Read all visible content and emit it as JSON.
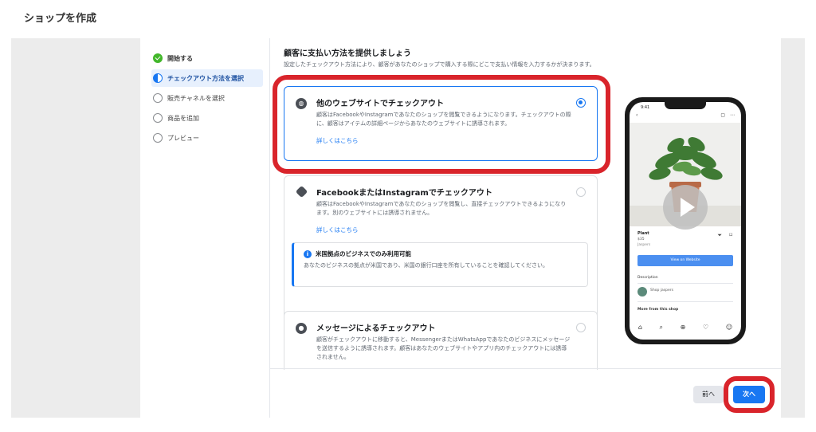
{
  "page": {
    "title": "ショップを作成"
  },
  "steps": [
    {
      "label": "開始する",
      "state": "done"
    },
    {
      "label": "チェックアウト方法を選択",
      "state": "active"
    },
    {
      "label": "販売チャネルを選択",
      "state": "todo"
    },
    {
      "label": "商品を追加",
      "state": "todo"
    },
    {
      "label": "プレビュー",
      "state": "todo"
    }
  ],
  "content": {
    "heading": "顧客に支払い方法を提供しましょう",
    "subheading": "設定したチェックアウト方法により、顧客があなたのショップで購入する際にどこで支払い情報を入力するかが決まります。"
  },
  "options": [
    {
      "title": "他のウェブサイトでチェックアウト",
      "description": "顧客はFacebookやInstagramであなたのショップを閲覧できるようになります。チェックアウトの際に、顧客はアイテムの詳細ページからあなたのウェブサイトに誘導されます。",
      "link": "詳しくはこちら",
      "selected": true
    },
    {
      "title": "FacebookまたはInstagramでチェックアウト",
      "description": "顧客はFacebookやInstagramであなたのショップを閲覧し、直接チェックアウトできるようになります。別のウェブサイトには誘導されません。",
      "link": "詳しくはこちら",
      "selected": false
    },
    {
      "title": "メッセージによるチェックアウト",
      "description": "顧客がチェックアウトに移動すると、MessengerまたはWhatsAppであなたのビジネスにメッセージを送信するように誘導されます。顧客はあなたのウェブサイトやアプリ内のチェックアウトには誘導されません。",
      "selected": false
    }
  ],
  "notice": {
    "title": "米国拠点のビジネスでのみ利用可能",
    "body": "あなたのビジネスの拠点が米国であり、米国の銀行口座を所有していることを確認してください。"
  },
  "phone": {
    "time": "9:41",
    "product_name": "Plant",
    "price": "$35",
    "brand": "Jaspers",
    "cta": "View on Website",
    "description_label": "Description",
    "shop_name": "Shop jaspers",
    "more_label": "More from this shop"
  },
  "footer": {
    "back_label": "前へ",
    "next_label": "次へ"
  },
  "colors": {
    "accent": "#1877f2",
    "highlight": "#d9242b",
    "done": "#42b72a"
  }
}
